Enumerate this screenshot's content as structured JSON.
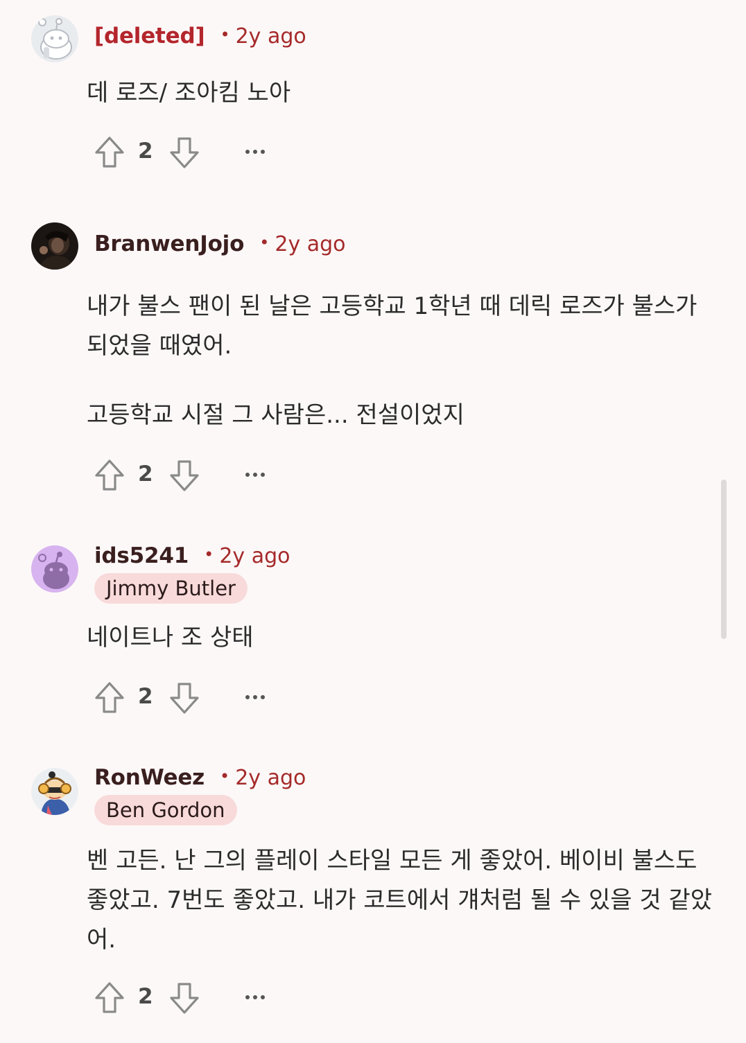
{
  "comments": [
    {
      "username": "[deleted]",
      "time": "2y ago",
      "flair": "",
      "body": [
        "데 로즈/ 조아킴 노아"
      ],
      "score": "2",
      "avatar_icon": "deleted-user-snoo-icon"
    },
    {
      "username": "BranwenJojo",
      "time": "2y ago",
      "flair": "",
      "body": [
        "내가 불스 팬이 된 날은 고등학교 1학년 때 데릭 로즈가 불스가 되었을 때였어.",
        "고등학교 시절 그 사람은... 전설이었지"
      ],
      "score": "2",
      "avatar_icon": "profile-photo-avatar"
    },
    {
      "username": "ids5241",
      "time": "2y ago",
      "flair": "Jimmy Butler",
      "body": [
        "네이트나 조 상태"
      ],
      "score": "2",
      "avatar_icon": "purple-snoo-icon"
    },
    {
      "username": "RonWeez",
      "time": "2y ago",
      "flair": "Ben Gordon",
      "body": [
        "벤 고든. 난 그의 플레이 스타일 모든 게 좋았어. 베이비 불스도 좋았고. 7번도 좋았고. 내가 코트에서 걔처럼 될 수 있을 것 같았어."
      ],
      "score": "2",
      "avatar_icon": "custom-snoo-avatar-icon"
    }
  ],
  "colors": {
    "background": "#fdf8f8",
    "username": "#3a1f1f",
    "deleted_username": "#b3262c",
    "timestamp": "#a52a2a",
    "flair_background": "#f8dada",
    "icon": "#8a8a8a"
  },
  "icons": {
    "upvote": "upvote-arrow-icon",
    "downvote": "downvote-arrow-icon",
    "more": "more-options-icon"
  }
}
